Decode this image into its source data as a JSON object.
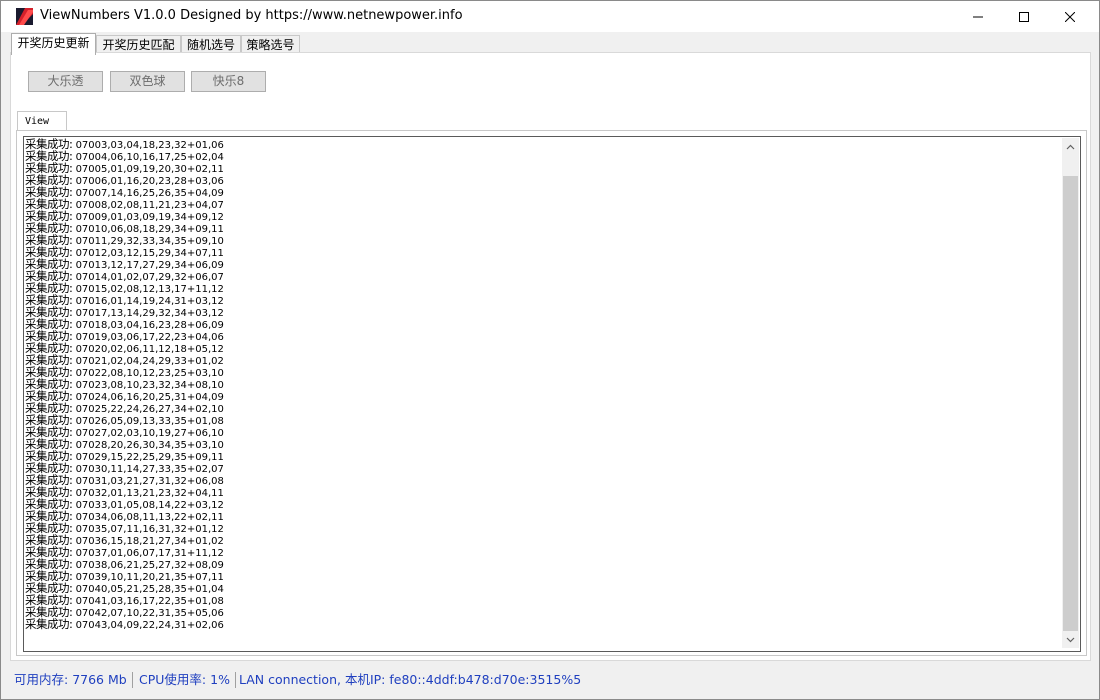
{
  "window": {
    "title": "ViewNumbers V1.0.0 Designed by https://www.netnewpower.info"
  },
  "tabs": [
    {
      "label": "开奖历史更新"
    },
    {
      "label": "开奖历史匹配"
    },
    {
      "label": "随机选号"
    },
    {
      "label": "策略选号"
    }
  ],
  "buttons": [
    {
      "label": "大乐透"
    },
    {
      "label": "双色球"
    },
    {
      "label": "快乐8"
    }
  ],
  "view_tab": {
    "label": "View"
  },
  "log": {
    "prefix": "采集成功:",
    "entries": [
      "07003,03,04,18,23,32+01,06",
      "07004,06,10,16,17,25+02,04",
      "07005,01,09,19,20,30+02,11",
      "07006,01,16,20,23,28+03,06",
      "07007,14,16,25,26,35+04,09",
      "07008,02,08,11,21,23+04,07",
      "07009,01,03,09,19,34+09,12",
      "07010,06,08,18,29,34+09,11",
      "07011,29,32,33,34,35+09,10",
      "07012,03,12,15,29,34+07,11",
      "07013,12,17,27,29,34+06,09",
      "07014,01,02,07,29,32+06,07",
      "07015,02,08,12,13,17+11,12",
      "07016,01,14,19,24,31+03,12",
      "07017,13,14,29,32,34+03,12",
      "07018,03,04,16,23,28+06,09",
      "07019,03,06,17,22,23+04,06",
      "07020,02,06,11,12,18+05,12",
      "07021,02,04,24,29,33+01,02",
      "07022,08,10,12,23,25+03,10",
      "07023,08,10,23,32,34+08,10",
      "07024,06,16,20,25,31+04,09",
      "07025,22,24,26,27,34+02,10",
      "07026,05,09,13,33,35+01,08",
      "07027,02,03,10,19,27+06,10",
      "07028,20,26,30,34,35+03,10",
      "07029,15,22,25,29,35+09,11",
      "07030,11,14,27,33,35+02,07",
      "07031,03,21,27,31,32+06,08",
      "07032,01,13,21,23,32+04,11",
      "07033,01,05,08,14,22+03,12",
      "07034,06,08,11,13,22+02,11",
      "07035,07,11,16,31,32+01,12",
      "07036,15,18,21,27,34+01,02",
      "07037,01,06,07,17,31+11,12",
      "07038,06,21,25,27,32+08,09",
      "07039,10,11,20,21,35+07,11",
      "07040,05,21,25,28,35+01,04",
      "07041,03,16,17,22,35+01,08",
      "07042,07,10,22,31,35+05,06",
      "07043,04,09,22,24,31+02,06"
    ]
  },
  "status": {
    "memory_label": "可用内存:",
    "memory_value": "7766 Mb",
    "cpu_label": "CPU使用率:",
    "cpu_value": "1%",
    "network": "LAN connection,  本机IP: fe80::4ddf:b478:d70e:3515%5"
  },
  "colors": {
    "status_text": "#1f3fbf",
    "button_bg": "#e1e1e1",
    "scroll_thumb": "#cdcdcd"
  }
}
